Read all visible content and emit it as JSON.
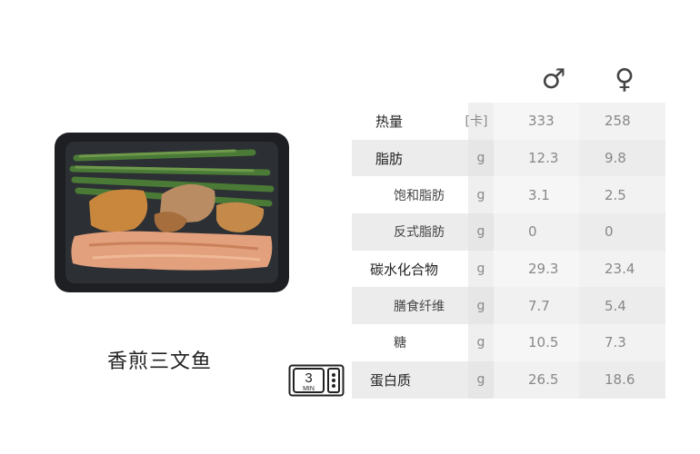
{
  "dish": {
    "name": "香煎三文鱼"
  },
  "microwave": {
    "minutes": "3",
    "unit": "MIN"
  },
  "columns": {
    "male_symbol": "♂",
    "female_symbol": "♀"
  },
  "nutrition": [
    {
      "name": "热量",
      "unit": "[卡]",
      "male": "333",
      "female": "258"
    },
    {
      "name": "脂肪",
      "unit": "g",
      "male": "12.3",
      "female": "9.8"
    },
    {
      "name": "饱和脂肪",
      "unit": "g",
      "male": "3.1",
      "female": "2.5"
    },
    {
      "name": "反式脂肪",
      "unit": "g",
      "male": "0",
      "female": "0"
    },
    {
      "name": "碳水化合物",
      "unit": "g",
      "male": "29.3",
      "female": "23.4"
    },
    {
      "name": "膳食纤维",
      "unit": "g",
      "male": "7.7",
      "female": "5.4"
    },
    {
      "name": "糖",
      "unit": "g",
      "male": "10.5",
      "female": "7.3"
    },
    {
      "name": "蛋白质",
      "unit": "g",
      "male": "26.5",
      "female": "18.6"
    }
  ]
}
